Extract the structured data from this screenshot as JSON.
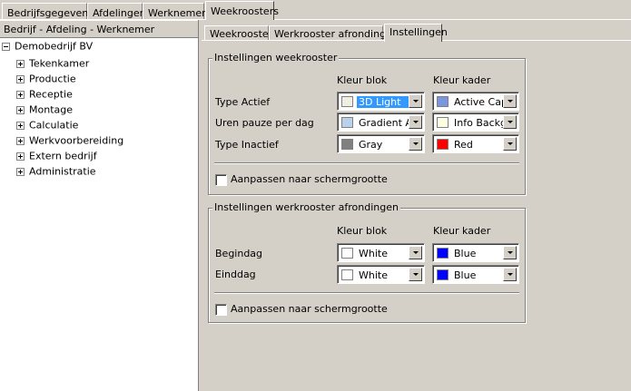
{
  "top_tabs": [
    {
      "label": "Bedrijfsgegevens"
    },
    {
      "label": "Afdelingen"
    },
    {
      "label": "Werknemers"
    },
    {
      "label": "Weekroosters"
    }
  ],
  "left_panel": {
    "header": "Bedrijf - Afdeling - Werknemer",
    "root": "Demobedrijf BV",
    "items": [
      {
        "label": "Tekenkamer"
      },
      {
        "label": "Productie"
      },
      {
        "label": "Receptie"
      },
      {
        "label": "Montage"
      },
      {
        "label": "Calculatie"
      },
      {
        "label": "Werkvoorbereiding"
      },
      {
        "label": "Extern bedrijf"
      },
      {
        "label": "Administratie"
      }
    ]
  },
  "inner_tabs": [
    {
      "label": "Weekrooster"
    },
    {
      "label": "Werkrooster afrondingen"
    },
    {
      "label": "Instellingen"
    }
  ],
  "group1": {
    "title": "Instellingen weekrooster",
    "col_block": "Kleur blok",
    "col_frame": "Kleur kader",
    "rows": [
      {
        "label": "Type Actief",
        "block": "3D Light",
        "block_color": "#f1efe2",
        "frame": "Active Caption",
        "frame_color": "#7a96df"
      },
      {
        "label": "Uren pauze per dag",
        "block": "Gradient Active Caption",
        "block_color": "#b9d1ea",
        "frame": "Info Background",
        "frame_color": "#ffffe1"
      },
      {
        "label": "Type Inactief",
        "block": "Gray",
        "block_color": "#808080",
        "frame": "Red",
        "frame_color": "#ff0000"
      }
    ],
    "checkbox_label": "Aanpassen naar schermgrootte"
  },
  "group2": {
    "title": "Instellingen werkrooster afrondingen",
    "col_block": "Kleur blok",
    "col_frame": "Kleur kader",
    "rows": [
      {
        "label": "Begindag",
        "block": "White",
        "block_color": "#ffffff",
        "frame": "Blue",
        "frame_color": "#0000ff"
      },
      {
        "label": "Einddag",
        "block": "White",
        "block_color": "#ffffff",
        "frame": "Blue",
        "frame_color": "#0000ff"
      }
    ],
    "checkbox_label": "Aanpassen naar schermgrootte"
  }
}
